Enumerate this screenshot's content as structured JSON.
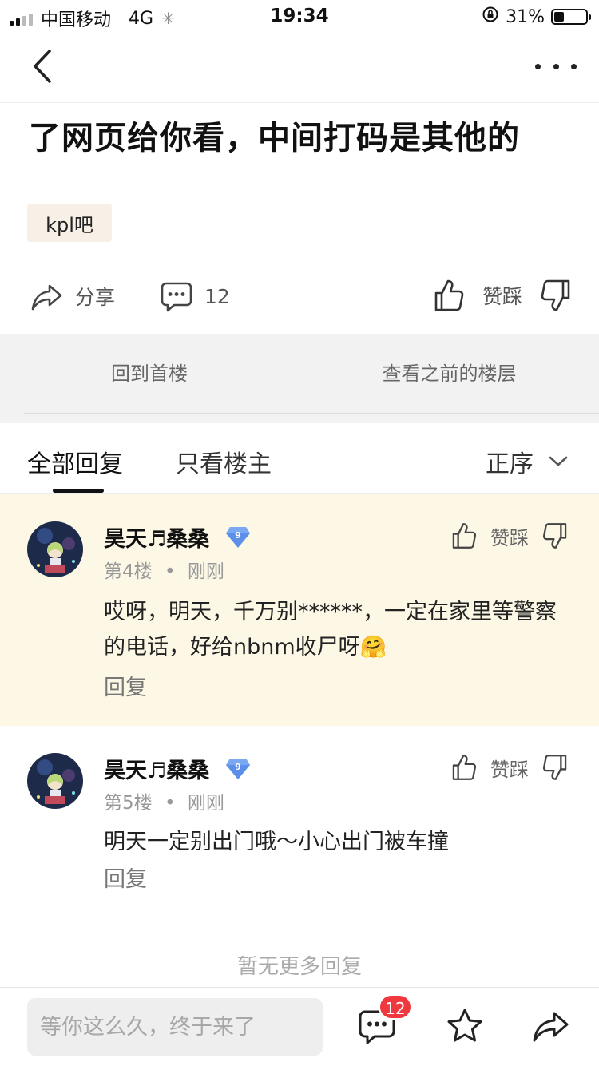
{
  "status_bar": {
    "carrier": "中国移动",
    "network": "4G",
    "time": "19:34",
    "battery": "31%",
    "battery_level": 0.31
  },
  "nav": {
    "back_icon": "chevron-left-icon",
    "more_icon": "more-dots-icon"
  },
  "post": {
    "title": "了网页给你看，中间打码是其他的",
    "forum": "kpl吧"
  },
  "actions": {
    "share": "分享",
    "comment_count": "12",
    "vote": "赞踩"
  },
  "floor_links": {
    "first": "回到首楼",
    "previous": "查看之前的楼层"
  },
  "tabs": {
    "all": "全部回复",
    "owner_only": "只看楼主",
    "sort": "正序"
  },
  "replies": [
    {
      "user": "昊天♬桑桑",
      "level": "9",
      "floor": "第4楼",
      "time": "刚刚",
      "text": "哎呀，明天，千万别******，一定在家里等警察的电话，好给nbnm收尸呀",
      "emoji": "🤗",
      "reply_label": "回复",
      "vote": "赞踩"
    },
    {
      "user": "昊天♬桑桑",
      "level": "9",
      "floor": "第5楼",
      "time": "刚刚",
      "text": "明天一定别出门哦～小心出门被车撞",
      "reply_label": "回复",
      "vote": "赞踩"
    }
  ],
  "no_more": "暂无更多回复",
  "bottom_bar": {
    "placeholder": "等你这么久，终于来了",
    "badge": "12"
  },
  "colors": {
    "accent_badge": "#f0393e",
    "highlight_bg": "#fdf8e6",
    "tag_bg": "#f8f0e6",
    "level_badge": "#5b8fe8"
  }
}
